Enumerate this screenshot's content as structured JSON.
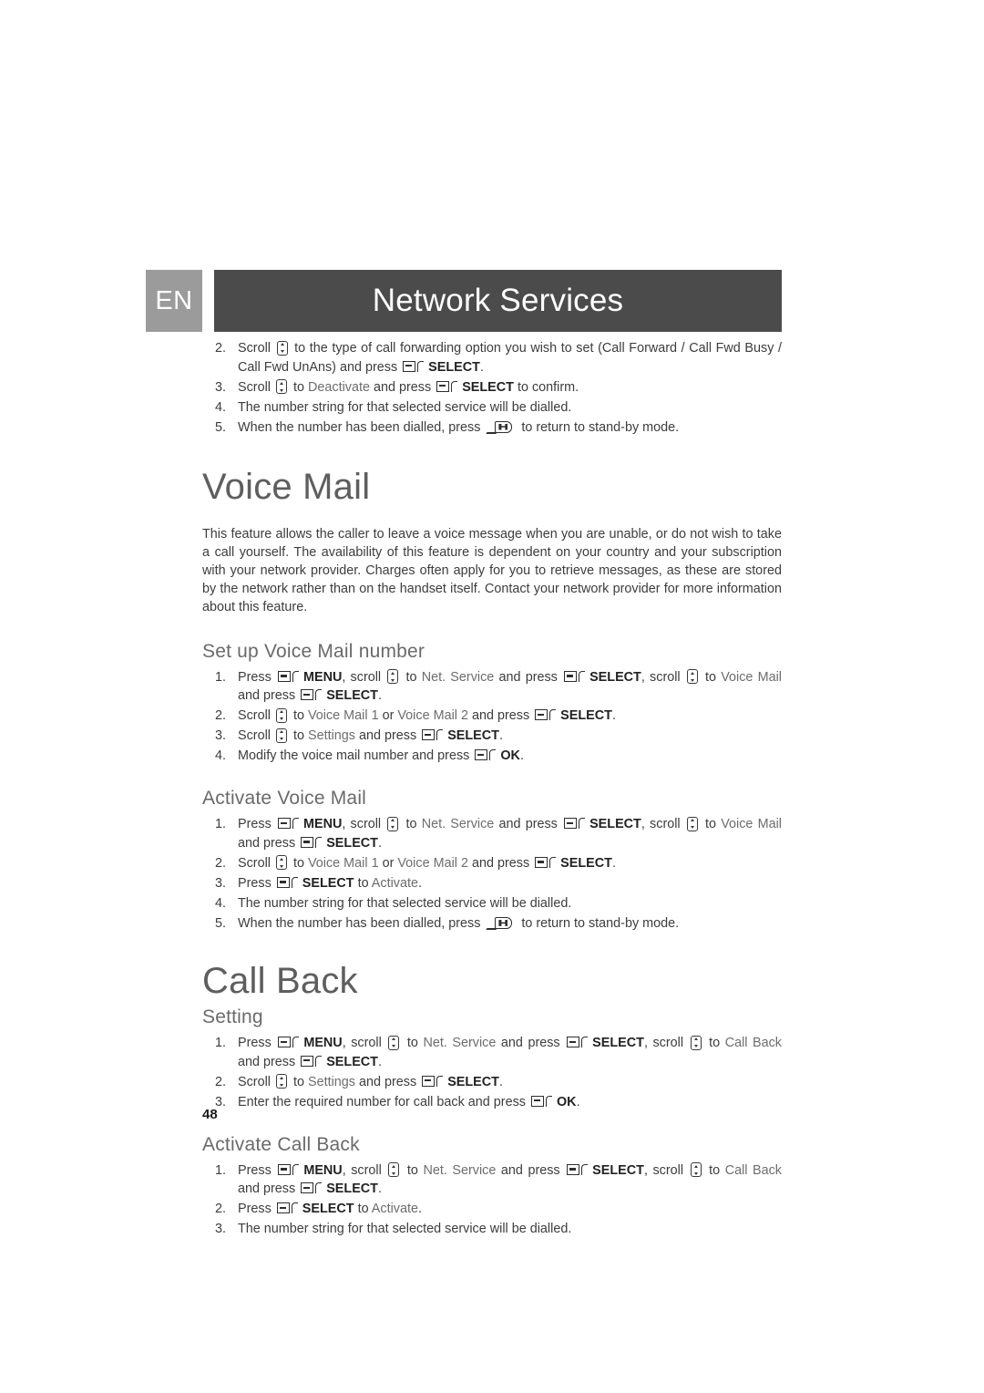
{
  "header": {
    "language_badge": "EN",
    "banner_title": "Network Services",
    "badge_color": "#9b9b9b",
    "banner_color": "#4b4b4b"
  },
  "intro_steps": {
    "items": [
      {
        "num": "2.",
        "parts": [
          {
            "t": "text",
            "v": "Scroll "
          },
          {
            "t": "icon",
            "v": "scroll-key-icon"
          },
          {
            "t": "text",
            "v": " to the type of call forwarding option you wish to set (Call Forward / Call Fwd Busy / Call Fwd UnAns) and press "
          },
          {
            "t": "icon",
            "v": "soft-key-icon"
          },
          {
            "t": "bold",
            "v": "SELECT"
          },
          {
            "t": "text",
            "v": "."
          }
        ]
      },
      {
        "num": "3.",
        "parts": [
          {
            "t": "text",
            "v": "Scroll "
          },
          {
            "t": "icon",
            "v": "scroll-key-icon"
          },
          {
            "t": "text",
            "v": " to "
          },
          {
            "t": "soft",
            "v": "Deactivate"
          },
          {
            "t": "text",
            "v": " and press "
          },
          {
            "t": "icon",
            "v": "soft-key-icon"
          },
          {
            "t": "bold",
            "v": "SELECT"
          },
          {
            "t": "text",
            "v": " to confirm."
          }
        ]
      },
      {
        "num": "4.",
        "parts": [
          {
            "t": "text",
            "v": "The number string for that selected service will be dialled."
          }
        ]
      },
      {
        "num": "5.",
        "parts": [
          {
            "t": "text",
            "v": "When the number has been dialled, press "
          },
          {
            "t": "icon",
            "v": "end-call-key-icon"
          },
          {
            "t": "text",
            "v": " to return to stand-by mode."
          }
        ]
      }
    ]
  },
  "voice_mail": {
    "title": "Voice Mail",
    "paragraph": "This feature allows the caller to leave a voice message when you are unable, or do not wish to take a call yourself. The availability of this feature is dependent on your country and your subscription with your network provider. Charges often apply for you to retrieve messages, as these are stored by the network rather than on the handset itself. Contact your network provider for more information about this feature.",
    "setup": {
      "heading": "Set up Voice Mail number",
      "items": [
        {
          "num": "1.",
          "parts": [
            {
              "t": "text",
              "v": "Press "
            },
            {
              "t": "icon",
              "v": "soft-key-icon"
            },
            {
              "t": "bold",
              "v": "MENU"
            },
            {
              "t": "text",
              "v": ", scroll "
            },
            {
              "t": "icon",
              "v": "scroll-key-icon"
            },
            {
              "t": "text",
              "v": " to "
            },
            {
              "t": "soft",
              "v": "Net. Service"
            },
            {
              "t": "text",
              "v": " and press "
            },
            {
              "t": "icon",
              "v": "soft-key-icon"
            },
            {
              "t": "bold",
              "v": "SELECT"
            },
            {
              "t": "text",
              "v": ", scroll "
            },
            {
              "t": "icon",
              "v": "scroll-key-icon"
            },
            {
              "t": "text",
              "v": " to "
            },
            {
              "t": "soft",
              "v": "Voice Mail"
            },
            {
              "t": "text",
              "v": " and press "
            },
            {
              "t": "icon",
              "v": "soft-key-icon"
            },
            {
              "t": "bold",
              "v": "SELECT"
            },
            {
              "t": "text",
              "v": "."
            }
          ]
        },
        {
          "num": "2.",
          "parts": [
            {
              "t": "text",
              "v": "Scroll "
            },
            {
              "t": "icon",
              "v": "scroll-key-icon"
            },
            {
              "t": "text",
              "v": " to "
            },
            {
              "t": "soft",
              "v": "Voice Mail 1"
            },
            {
              "t": "text",
              "v": " or "
            },
            {
              "t": "soft",
              "v": "Voice Mail 2"
            },
            {
              "t": "text",
              "v": " and press "
            },
            {
              "t": "icon",
              "v": "soft-key-icon"
            },
            {
              "t": "bold",
              "v": "SELECT"
            },
            {
              "t": "text",
              "v": "."
            }
          ]
        },
        {
          "num": "3.",
          "parts": [
            {
              "t": "text",
              "v": "Scroll "
            },
            {
              "t": "icon",
              "v": "scroll-key-icon"
            },
            {
              "t": "text",
              "v": " to "
            },
            {
              "t": "soft",
              "v": "Settings"
            },
            {
              "t": "text",
              "v": " and press "
            },
            {
              "t": "icon",
              "v": "soft-key-icon"
            },
            {
              "t": "bold",
              "v": "SELECT"
            },
            {
              "t": "text",
              "v": "."
            }
          ]
        },
        {
          "num": "4.",
          "parts": [
            {
              "t": "text",
              "v": "Modify the voice mail number and press "
            },
            {
              "t": "icon",
              "v": "soft-key-icon"
            },
            {
              "t": "bold",
              "v": "OK"
            },
            {
              "t": "text",
              "v": "."
            }
          ]
        }
      ]
    },
    "activate": {
      "heading": "Activate Voice Mail",
      "items": [
        {
          "num": "1.",
          "parts": [
            {
              "t": "text",
              "v": "Press "
            },
            {
              "t": "icon",
              "v": "soft-key-icon"
            },
            {
              "t": "bold",
              "v": "MENU"
            },
            {
              "t": "text",
              "v": ", scroll "
            },
            {
              "t": "icon",
              "v": "scroll-key-icon"
            },
            {
              "t": "text",
              "v": " to "
            },
            {
              "t": "soft",
              "v": "Net. Service"
            },
            {
              "t": "text",
              "v": " and press "
            },
            {
              "t": "icon",
              "v": "soft-key-icon"
            },
            {
              "t": "bold",
              "v": "SELECT"
            },
            {
              "t": "text",
              "v": ", scroll "
            },
            {
              "t": "icon",
              "v": "scroll-key-icon"
            },
            {
              "t": "text",
              "v": " to "
            },
            {
              "t": "soft",
              "v": "Voice Mail"
            },
            {
              "t": "text",
              "v": " and press "
            },
            {
              "t": "icon",
              "v": "soft-key-icon"
            },
            {
              "t": "bold",
              "v": "SELECT"
            },
            {
              "t": "text",
              "v": "."
            }
          ]
        },
        {
          "num": "2.",
          "parts": [
            {
              "t": "text",
              "v": "Scroll "
            },
            {
              "t": "icon",
              "v": "scroll-key-icon"
            },
            {
              "t": "text",
              "v": " to "
            },
            {
              "t": "soft",
              "v": "Voice Mail 1"
            },
            {
              "t": "text",
              "v": " or "
            },
            {
              "t": "soft",
              "v": "Voice Mail 2"
            },
            {
              "t": "text",
              "v": " and press "
            },
            {
              "t": "icon",
              "v": "soft-key-icon"
            },
            {
              "t": "bold",
              "v": "SELECT"
            },
            {
              "t": "text",
              "v": "."
            }
          ]
        },
        {
          "num": "3.",
          "parts": [
            {
              "t": "text",
              "v": "Press "
            },
            {
              "t": "icon",
              "v": "soft-key-icon"
            },
            {
              "t": "bold",
              "v": "SELECT"
            },
            {
              "t": "text",
              "v": " to "
            },
            {
              "t": "soft",
              "v": "Activate"
            },
            {
              "t": "text",
              "v": "."
            }
          ]
        },
        {
          "num": "4.",
          "parts": [
            {
              "t": "text",
              "v": "The number string for that selected service will be dialled."
            }
          ]
        },
        {
          "num": "5.",
          "parts": [
            {
              "t": "text",
              "v": "When the number has been dialled, press "
            },
            {
              "t": "icon",
              "v": "end-call-key-icon"
            },
            {
              "t": "text",
              "v": " to return to stand-by mode."
            }
          ]
        }
      ]
    }
  },
  "call_back": {
    "title": "Call Back",
    "setting": {
      "heading": "Setting",
      "items": [
        {
          "num": "1.",
          "parts": [
            {
              "t": "text",
              "v": "Press "
            },
            {
              "t": "icon",
              "v": "soft-key-icon"
            },
            {
              "t": "bold",
              "v": "MENU"
            },
            {
              "t": "text",
              "v": ", scroll "
            },
            {
              "t": "icon",
              "v": "scroll-key-icon"
            },
            {
              "t": "text",
              "v": " to "
            },
            {
              "t": "soft",
              "v": "Net. Service"
            },
            {
              "t": "text",
              "v": " and press "
            },
            {
              "t": "icon",
              "v": "soft-key-icon"
            },
            {
              "t": "bold",
              "v": "SELECT"
            },
            {
              "t": "text",
              "v": ", scroll "
            },
            {
              "t": "icon",
              "v": "scroll-key-icon"
            },
            {
              "t": "text",
              "v": " to "
            },
            {
              "t": "soft",
              "v": "Call Back"
            },
            {
              "t": "text",
              "v": " and press "
            },
            {
              "t": "icon",
              "v": "soft-key-icon"
            },
            {
              "t": "bold",
              "v": "SELECT"
            },
            {
              "t": "text",
              "v": "."
            }
          ]
        },
        {
          "num": "2.",
          "parts": [
            {
              "t": "text",
              "v": "Scroll "
            },
            {
              "t": "icon",
              "v": "scroll-key-icon"
            },
            {
              "t": "text",
              "v": " to "
            },
            {
              "t": "soft",
              "v": "Settings"
            },
            {
              "t": "text",
              "v": " and press "
            },
            {
              "t": "icon",
              "v": "soft-key-icon"
            },
            {
              "t": "bold",
              "v": "SELECT"
            },
            {
              "t": "text",
              "v": "."
            }
          ]
        },
        {
          "num": "3.",
          "parts": [
            {
              "t": "text",
              "v": "Enter the required number for call back and press "
            },
            {
              "t": "icon",
              "v": "soft-key-icon"
            },
            {
              "t": "bold",
              "v": "OK"
            },
            {
              "t": "text",
              "v": "."
            }
          ]
        }
      ]
    },
    "activate": {
      "heading": "Activate Call Back",
      "items": [
        {
          "num": "1.",
          "parts": [
            {
              "t": "text",
              "v": "Press "
            },
            {
              "t": "icon",
              "v": "soft-key-icon"
            },
            {
              "t": "bold",
              "v": "MENU"
            },
            {
              "t": "text",
              "v": ", scroll "
            },
            {
              "t": "icon",
              "v": "scroll-key-icon"
            },
            {
              "t": "text",
              "v": " to "
            },
            {
              "t": "soft",
              "v": "Net. Service"
            },
            {
              "t": "text",
              "v": " and press "
            },
            {
              "t": "icon",
              "v": "soft-key-icon"
            },
            {
              "t": "bold",
              "v": "SELECT"
            },
            {
              "t": "text",
              "v": ", scroll "
            },
            {
              "t": "icon",
              "v": "scroll-key-icon"
            },
            {
              "t": "text",
              "v": " to "
            },
            {
              "t": "soft",
              "v": "Call Back"
            },
            {
              "t": "text",
              "v": " and press "
            },
            {
              "t": "icon",
              "v": "soft-key-icon"
            },
            {
              "t": "bold",
              "v": "SELECT"
            },
            {
              "t": "text",
              "v": "."
            }
          ]
        },
        {
          "num": "2.",
          "parts": [
            {
              "t": "text",
              "v": "Press "
            },
            {
              "t": "icon",
              "v": "soft-key-icon"
            },
            {
              "t": "bold",
              "v": "SELECT"
            },
            {
              "t": "text",
              "v": " to "
            },
            {
              "t": "soft",
              "v": "Activate"
            },
            {
              "t": "text",
              "v": "."
            }
          ]
        },
        {
          "num": "3.",
          "parts": [
            {
              "t": "text",
              "v": "The number string for that selected service will be dialled."
            }
          ]
        }
      ]
    }
  },
  "footer": {
    "page_number": "48"
  }
}
